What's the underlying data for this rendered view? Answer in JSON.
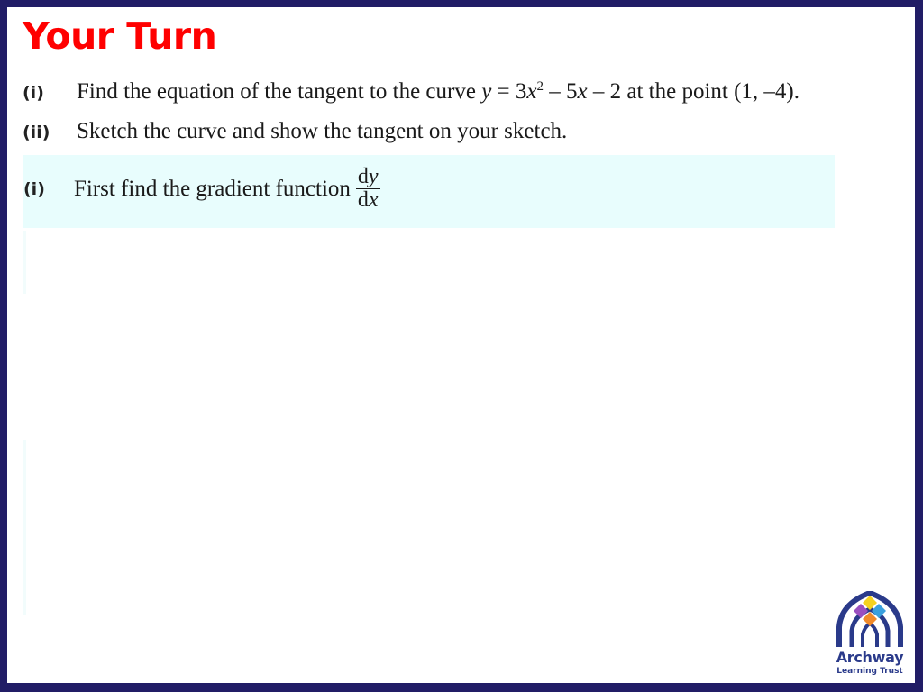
{
  "slide": {
    "title": "Your Turn",
    "title_color": "#ff0000",
    "border_color": "#211d66",
    "questions": [
      {
        "label": "(i)",
        "text_before": "Find the equation of the tangent to the curve ",
        "equation_y": "y",
        "equation_eq": " = 3",
        "equation_x": "x",
        "equation_sup": "2",
        "equation_rest_1": " – 5",
        "equation_x2": "x",
        "equation_rest_2": " – 2",
        "text_after": " at the point (1, –4)."
      },
      {
        "label": "(ii)",
        "text": "Sketch the curve and show the tangent on your sketch."
      }
    ],
    "answer": {
      "label": "(i)",
      "text": "First find the gradient function ",
      "frac_num_d": "d",
      "frac_num_var": "y",
      "frac_den_d": "d",
      "frac_den_var": "x",
      "background": "#e8fdfd"
    },
    "logo": {
      "name": "Archway",
      "subtitle": "Learning Trust",
      "colors": {
        "yellow": "#f5d21f",
        "purple": "#9a4fc0",
        "blue": "#3aa0de",
        "orange": "#f18a2a",
        "navy": "#2a3a8a"
      }
    }
  }
}
